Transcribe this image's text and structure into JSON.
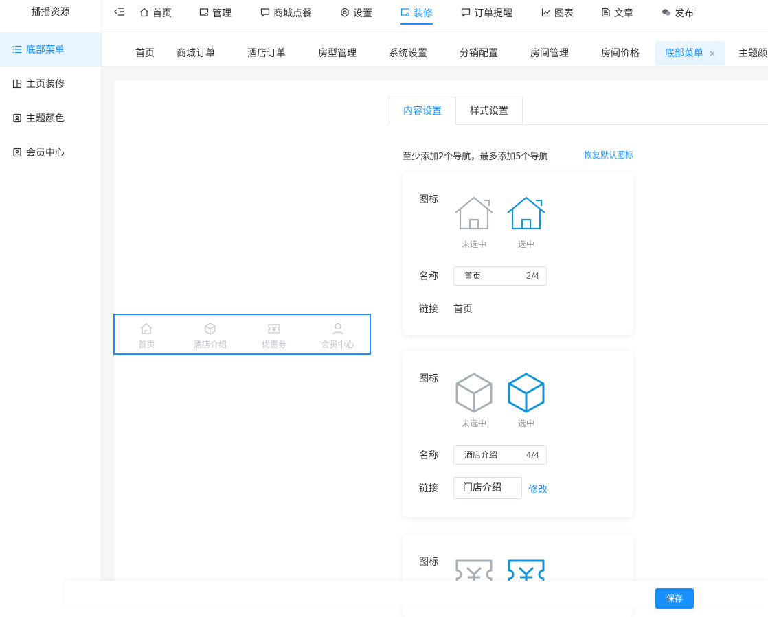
{
  "sidebar": {
    "brand": "播播资源",
    "items": [
      {
        "label": "底部菜单",
        "active": true,
        "icon": "list-icon"
      },
      {
        "label": "主页装修",
        "active": false,
        "icon": "layout-icon"
      },
      {
        "label": "主题颜色",
        "active": false,
        "icon": "doc-icon"
      },
      {
        "label": "会员中心",
        "active": false,
        "icon": "doc-icon"
      }
    ]
  },
  "topnav": {
    "items": [
      {
        "label": "首页",
        "icon": "home-icon"
      },
      {
        "label": "管理",
        "icon": "monitor-icon"
      },
      {
        "label": "商城点餐",
        "icon": "message-icon"
      },
      {
        "label": "设置",
        "icon": "gear-icon"
      },
      {
        "label": "装修",
        "icon": "monitor-icon",
        "active": true
      },
      {
        "label": "订单提醒",
        "icon": "message-icon"
      },
      {
        "label": "图表",
        "icon": "chart-icon"
      },
      {
        "label": "文章",
        "icon": "document-icon"
      },
      {
        "label": "发布",
        "icon": "wechat-icon"
      }
    ]
  },
  "tabs": {
    "items": [
      {
        "label": "首页"
      },
      {
        "label": "商城订单"
      },
      {
        "label": "酒店订单"
      },
      {
        "label": "房型管理"
      },
      {
        "label": "系统设置"
      },
      {
        "label": "分销配置"
      },
      {
        "label": "房间管理"
      },
      {
        "label": "房间价格"
      },
      {
        "label": "底部菜单",
        "active": true,
        "close": "×"
      },
      {
        "label": "主题颜"
      }
    ]
  },
  "preview": {
    "items": [
      {
        "label": "首页",
        "icon": "home-icon"
      },
      {
        "label": "酒店介绍",
        "icon": "cube-icon"
      },
      {
        "label": "优惠券",
        "icon": "ticket-icon"
      },
      {
        "label": "会员中心",
        "icon": "user-icon"
      }
    ]
  },
  "content": {
    "tabs": [
      "内容设置",
      "样式设置"
    ],
    "hint": "至少添加2个导航，最多添加5个导航",
    "restore": "恢复默认图标",
    "labels": {
      "icon": "图标",
      "name": "名称",
      "link": "链接",
      "unselected": "未选中",
      "selected": "选中",
      "edit": "修改"
    },
    "cards": [
      {
        "icon": "home-icon",
        "name": "首页",
        "count": "2/4",
        "link": "首页"
      },
      {
        "icon": "cube-icon",
        "name": "酒店介绍",
        "count": "4/4",
        "link": "门店介绍"
      },
      {
        "icon": "ticket-icon"
      }
    ]
  },
  "footer": {
    "save": "保存"
  },
  "colors": {
    "accent": "#1890ff",
    "icon_gray": "#a7b0b6",
    "icon_blue": "#1296db"
  }
}
